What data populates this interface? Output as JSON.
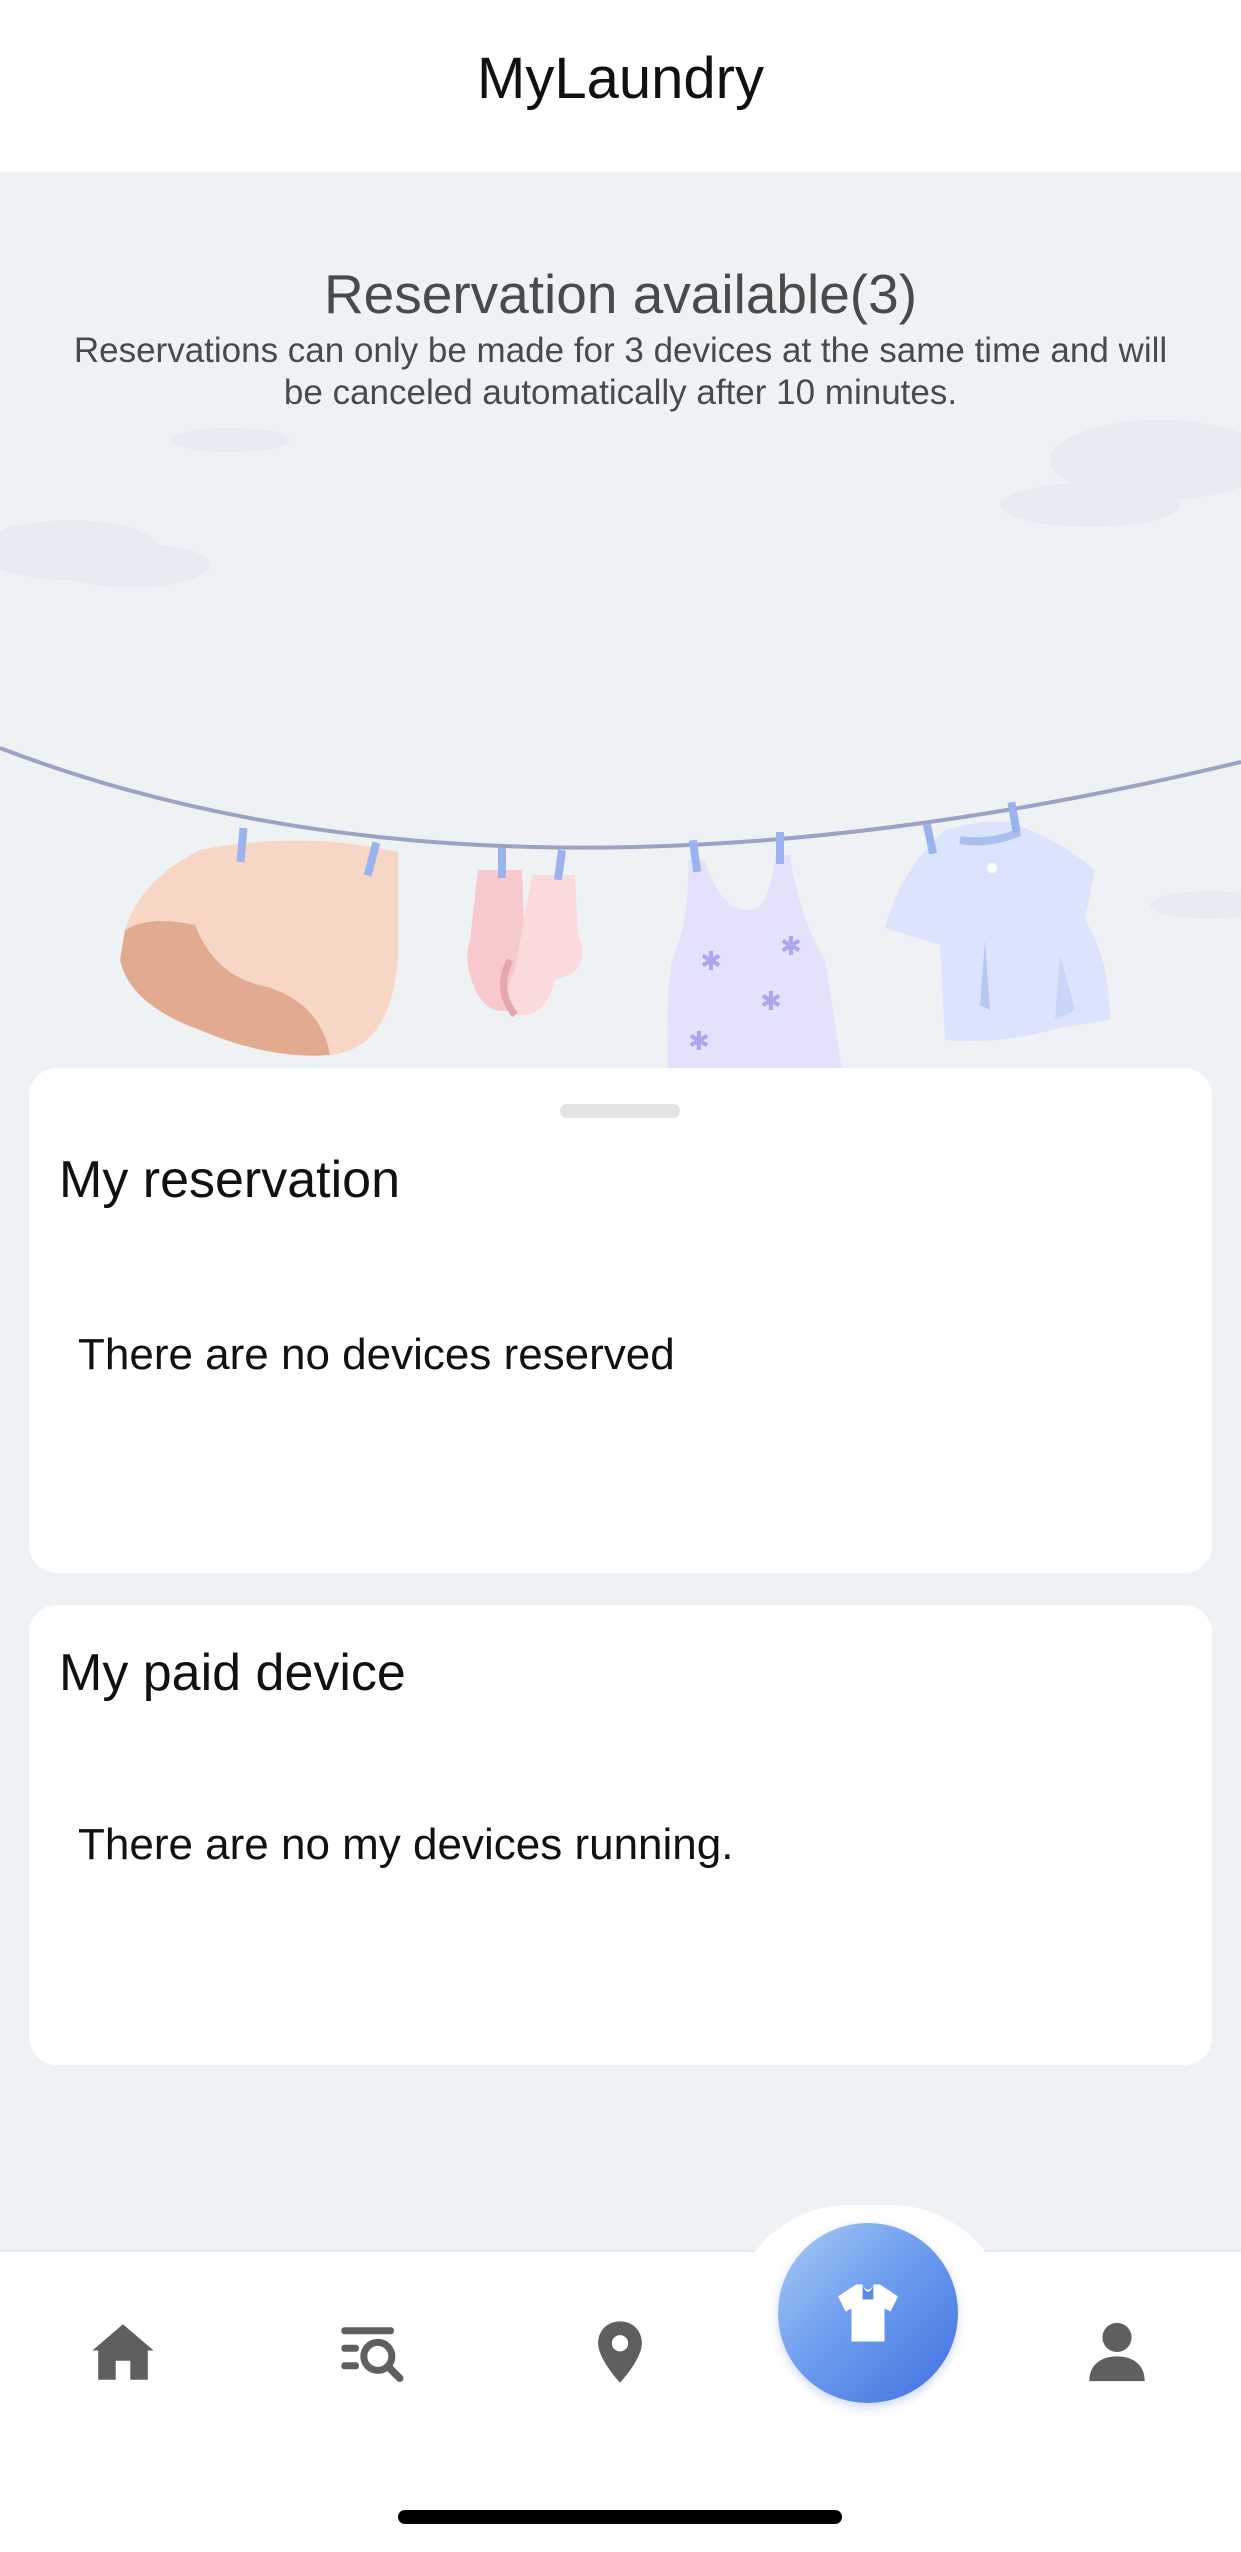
{
  "header": {
    "title": "MyLaundry"
  },
  "reservation_info": {
    "title": "Reservation available(3)",
    "description": "Reservations can only be made for 3 devices at the same time and will be canceled automatically after 10 minutes."
  },
  "my_reservation": {
    "title": "My reservation",
    "empty_text": "There are no devices reserved"
  },
  "my_paid_device": {
    "title": "My paid device",
    "empty_text": "There are no my devices running."
  },
  "tabbar": {
    "items": [
      {
        "icon": "home-icon"
      },
      {
        "icon": "search-list-icon"
      },
      {
        "icon": "location-pin-icon"
      },
      {
        "icon": "shirt-icon",
        "active": true
      },
      {
        "icon": "person-icon"
      }
    ]
  },
  "colors": {
    "background": "#eff2f5",
    "accent_gradient_start": "#a9cbf5",
    "accent_gradient_end": "#3e6fe0",
    "icon_gray": "#5f5f5f"
  }
}
